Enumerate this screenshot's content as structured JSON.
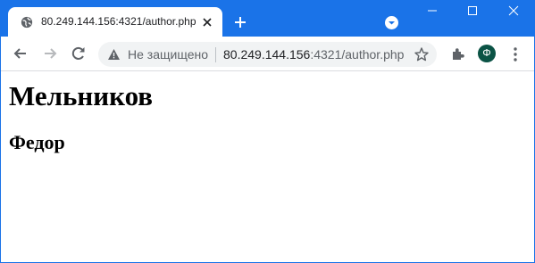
{
  "tab": {
    "title": "80.249.144.156:4321/author.php",
    "favicon": "globe-icon"
  },
  "omnibox": {
    "security_label": "Не защищено",
    "url_host": "80.249.144.156",
    "url_port": ":4321",
    "url_path": "/author.php"
  },
  "profile": {
    "initial": "Ф"
  },
  "page": {
    "heading": "Мельников",
    "subheading": "Федор"
  },
  "colors": {
    "titlebar": "#1a73e8",
    "omnibox_bg": "#f1f3f4",
    "avatar_bg": "#0b5345"
  }
}
